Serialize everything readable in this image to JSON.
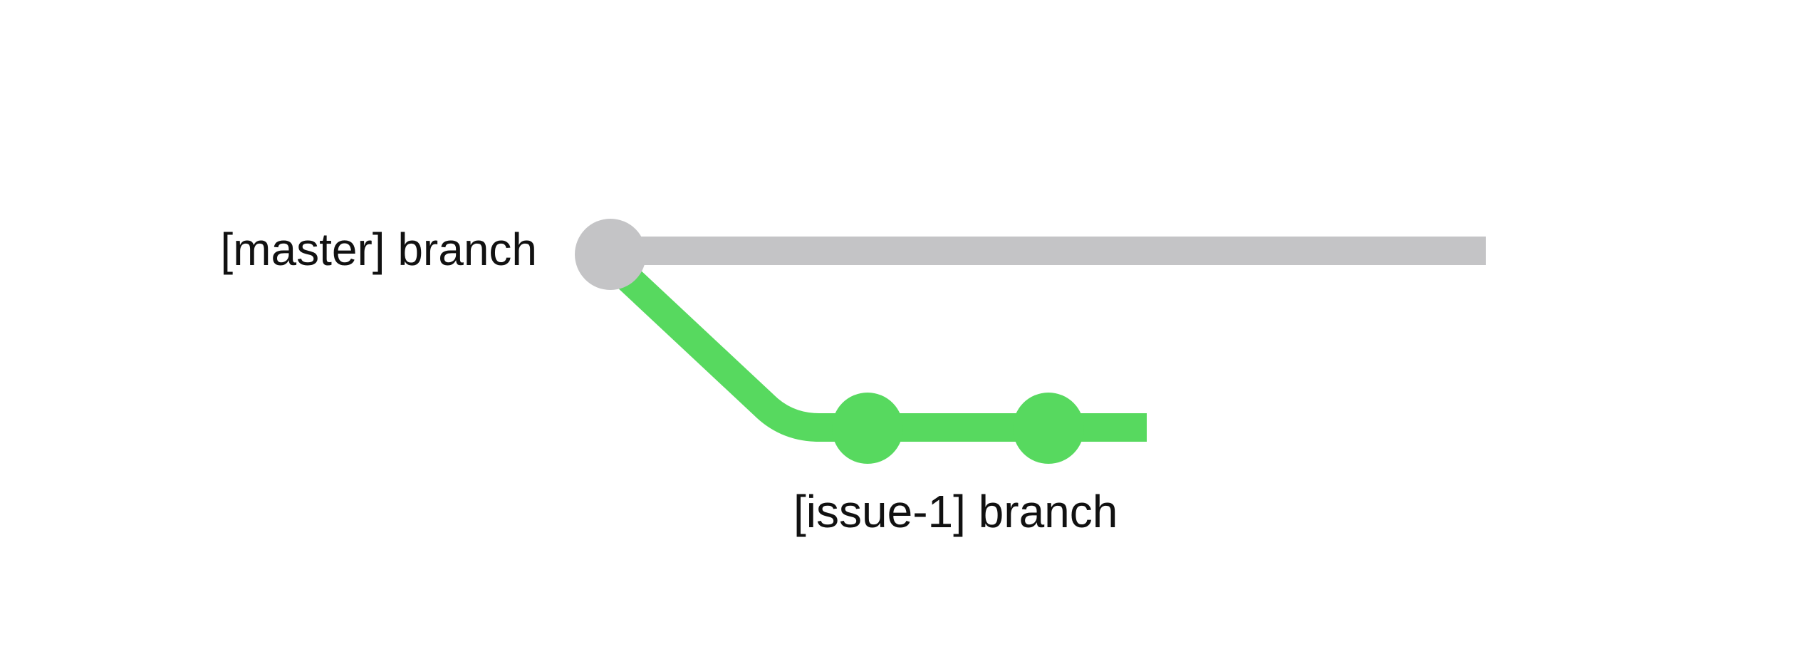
{
  "branches": {
    "master": {
      "label": "[master] branch",
      "color": "#c4c4c6"
    },
    "issue": {
      "label": "[issue-1] branch",
      "color": "#57d95f"
    }
  }
}
